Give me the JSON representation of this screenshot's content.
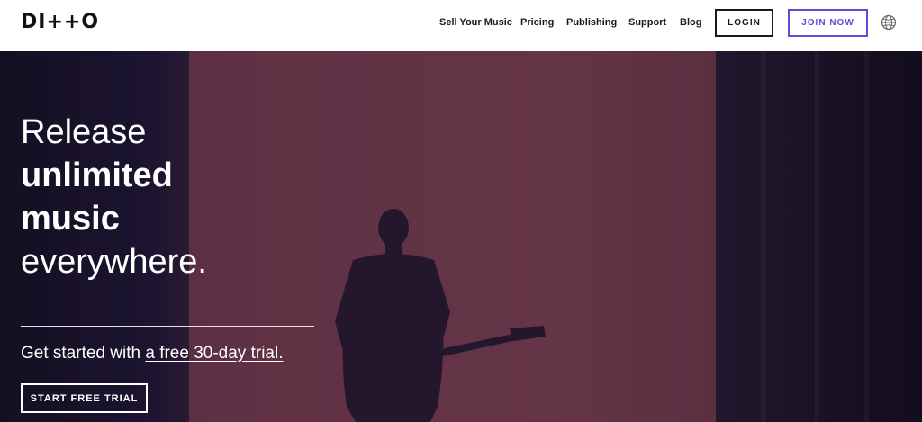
{
  "brand": {
    "logo_text": "DI++O"
  },
  "nav": {
    "links": [
      "Sell Your Music",
      "Pricing",
      "Publishing",
      "Support",
      "Blog"
    ],
    "login_label": "LOGIN",
    "join_label": "JOIN NOW",
    "language_icon": "globe-icon"
  },
  "hero": {
    "headline": {
      "line1": "Release",
      "line2": "unlimited",
      "line3": "music",
      "line4": "everywhere."
    },
    "subtext_prefix": "Get started with ",
    "subtext_link": "a free 30-day trial.",
    "cta_label": "START FREE TRIAL"
  },
  "colors": {
    "accent": "#5a4fd6",
    "hero_wall": "#5e3040",
    "hero_dark": "#1f1531",
    "text_dark": "#1a1a1a"
  }
}
